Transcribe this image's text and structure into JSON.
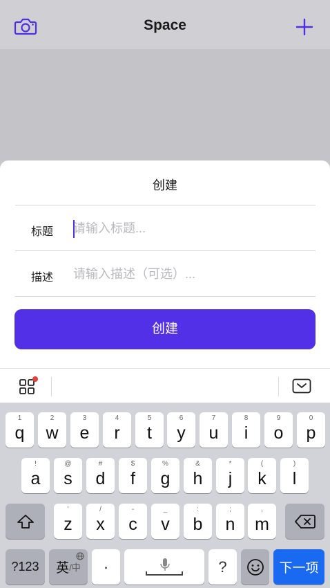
{
  "nav": {
    "title": "Space"
  },
  "sheet": {
    "title": "创建",
    "fields": [
      {
        "label": "标题",
        "placeholder": "请输入标题...",
        "value": ""
      },
      {
        "label": "描述",
        "placeholder": "请输入描述（可选）...",
        "value": ""
      }
    ],
    "create_label": "创建"
  },
  "keyboard": {
    "row1": [
      {
        "main": "q",
        "sub": "1"
      },
      {
        "main": "w",
        "sub": "2"
      },
      {
        "main": "e",
        "sub": "3"
      },
      {
        "main": "r",
        "sub": "4"
      },
      {
        "main": "t",
        "sub": "5"
      },
      {
        "main": "y",
        "sub": "6"
      },
      {
        "main": "u",
        "sub": "7"
      },
      {
        "main": "i",
        "sub": "8"
      },
      {
        "main": "o",
        "sub": "9"
      },
      {
        "main": "p",
        "sub": "0"
      }
    ],
    "row2": [
      {
        "main": "a",
        "sub": "!"
      },
      {
        "main": "s",
        "sub": "@"
      },
      {
        "main": "d",
        "sub": "#"
      },
      {
        "main": "f",
        "sub": "$"
      },
      {
        "main": "g",
        "sub": "%"
      },
      {
        "main": "h",
        "sub": "&"
      },
      {
        "main": "j",
        "sub": "*"
      },
      {
        "main": "k",
        "sub": "("
      },
      {
        "main": "l",
        "sub": ")"
      }
    ],
    "row3": [
      {
        "main": "z",
        "sub": "'"
      },
      {
        "main": "x",
        "sub": "/"
      },
      {
        "main": "c",
        "sub": "-"
      },
      {
        "main": "v",
        "sub": "_"
      },
      {
        "main": "b",
        "sub": ":"
      },
      {
        "main": "n",
        "sub": ";"
      },
      {
        "main": "m",
        "sub": ","
      }
    ],
    "numbers_label": "?123",
    "lang_label": "英",
    "lang_sub": "/中",
    "dot_label": "·",
    "question_label": "?",
    "next_label": "下一项"
  },
  "colors": {
    "accent": "#5230e8",
    "next_key": "#1a6af1",
    "badge": "#e0413a"
  },
  "icons": [
    "camera-icon",
    "plus-icon",
    "apps-grid-icon",
    "keyboard-hide-icon",
    "shift-icon",
    "backspace-icon",
    "globe-icon",
    "microphone-icon",
    "emoji-icon"
  ]
}
